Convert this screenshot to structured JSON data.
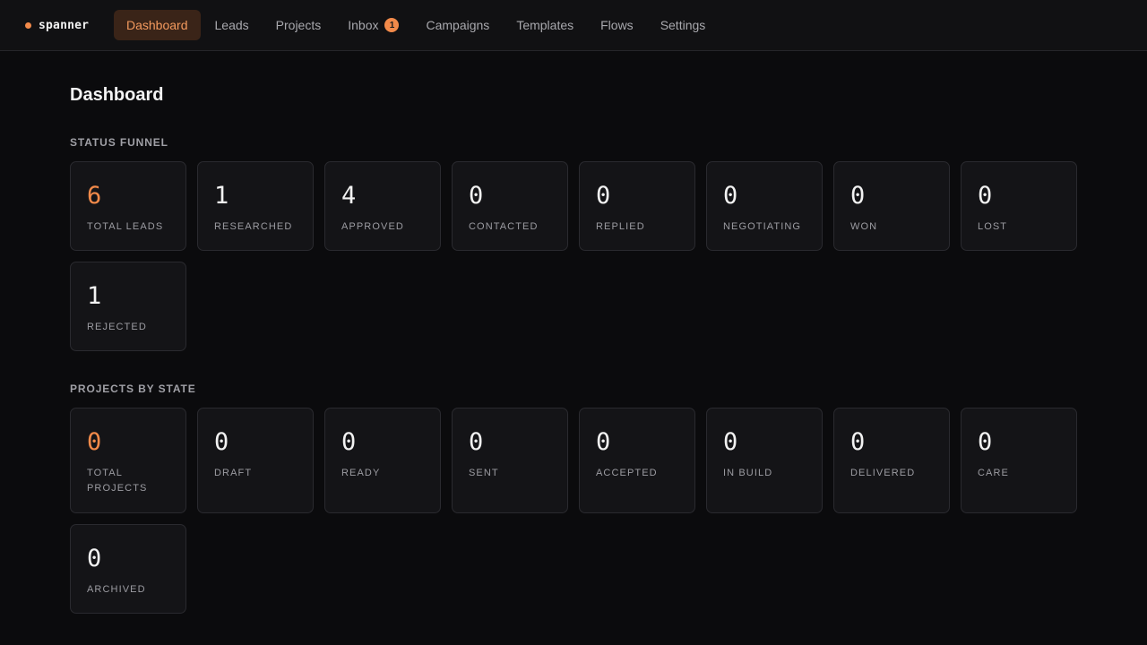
{
  "brand": {
    "name": "spanner"
  },
  "nav": {
    "items": [
      {
        "label": "Dashboard",
        "active": true
      },
      {
        "label": "Leads"
      },
      {
        "label": "Projects"
      },
      {
        "label": "Inbox",
        "badge": "1"
      },
      {
        "label": "Campaigns"
      },
      {
        "label": "Templates"
      },
      {
        "label": "Flows"
      },
      {
        "label": "Settings"
      }
    ]
  },
  "page": {
    "title": "Dashboard"
  },
  "funnel": {
    "title": "STATUS FUNNEL",
    "cards": [
      {
        "value": "6",
        "label": "TOTAL LEADS"
      },
      {
        "value": "1",
        "label": "RESEARCHED"
      },
      {
        "value": "4",
        "label": "APPROVED"
      },
      {
        "value": "0",
        "label": "CONTACTED"
      },
      {
        "value": "0",
        "label": "REPLIED"
      },
      {
        "value": "0",
        "label": "NEGOTIATING"
      },
      {
        "value": "0",
        "label": "WON"
      },
      {
        "value": "0",
        "label": "LOST"
      },
      {
        "value": "1",
        "label": "REJECTED"
      }
    ]
  },
  "projects": {
    "title": "PROJECTS BY STATE",
    "cards": [
      {
        "value": "0",
        "label": "TOTAL PROJECTS"
      },
      {
        "value": "0",
        "label": "DRAFT"
      },
      {
        "value": "0",
        "label": "READY"
      },
      {
        "value": "0",
        "label": "SENT"
      },
      {
        "value": "0",
        "label": "ACCEPTED"
      },
      {
        "value": "0",
        "label": "IN BUILD"
      },
      {
        "value": "0",
        "label": "DELIVERED"
      },
      {
        "value": "0",
        "label": "CARE"
      },
      {
        "value": "0",
        "label": "ARCHIVED"
      }
    ]
  },
  "colors": {
    "accent": "#f28a4a",
    "background": "#0b0b0d",
    "card": "#141417"
  }
}
